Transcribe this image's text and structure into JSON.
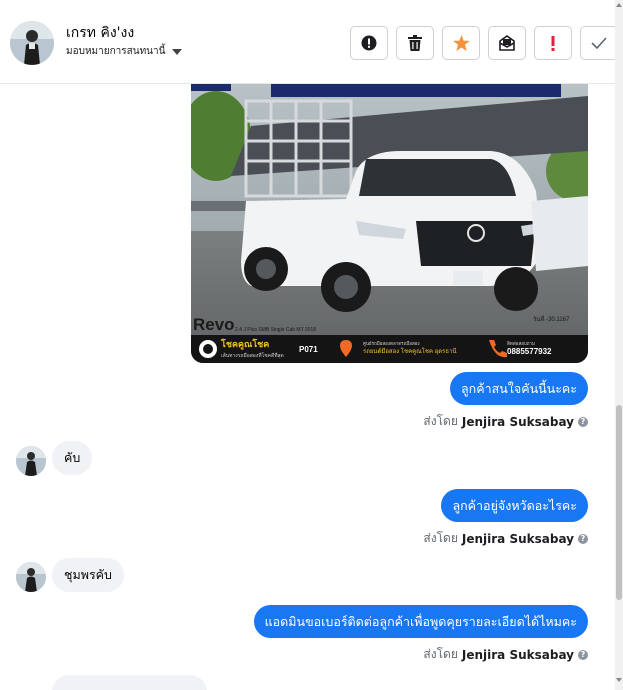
{
  "header": {
    "contact_name": "เกรท คิง'งง",
    "assign_label": "มอบหมายการสนทนานี้"
  },
  "toolbar": {
    "buttons": [
      "alert-icon",
      "trash-icon",
      "star-icon",
      "mark-unread-icon",
      "exclamation-icon",
      "check-icon"
    ]
  },
  "listing_image": {
    "model": "Revo",
    "model_spec": "2.4 J Plus SMB Single Cab MT 2018",
    "plate_info": "วันที่ -30.1167",
    "brand": "โชคคูณโชค",
    "brand_tagline": "เส้นทางรถมือสองที่โชคดีที่สุด",
    "stock_code": "P071",
    "location_label": "ศูนย์รถมือสองตลาดรถมือสอง",
    "location_name": "รถยนต์มือสอง โชคคูณโชค อุดรธานี",
    "contact_label": "ติดต่อสอบถาม",
    "phone": "0885577932"
  },
  "messages": [
    {
      "type": "out",
      "text": "ลูกค้าสนใจคันนี้นะคะ",
      "sent_by_prefix": "ส่งโดย",
      "sender": "Jenjira Suksabay"
    },
    {
      "type": "in",
      "text": "คับ"
    },
    {
      "type": "out",
      "text": "ลูกค้าอยู่จังหวัดอะไรคะ",
      "sent_by_prefix": "ส่งโดย",
      "sender": "Jenjira Suksabay"
    },
    {
      "type": "in",
      "text": "ชุมพรคับ"
    },
    {
      "type": "out",
      "text": "แอดมินขอเบอร์ติดต่อลูกค้าเพื่อพูดคุยรายละเอียดได้ไหมคะ",
      "sent_by_prefix": "ส่งโดย",
      "sender": "Jenjira Suksabay"
    }
  ],
  "colors": {
    "accent": "#1877f2",
    "star": "#f7923a",
    "danger": "#e41e3f"
  }
}
